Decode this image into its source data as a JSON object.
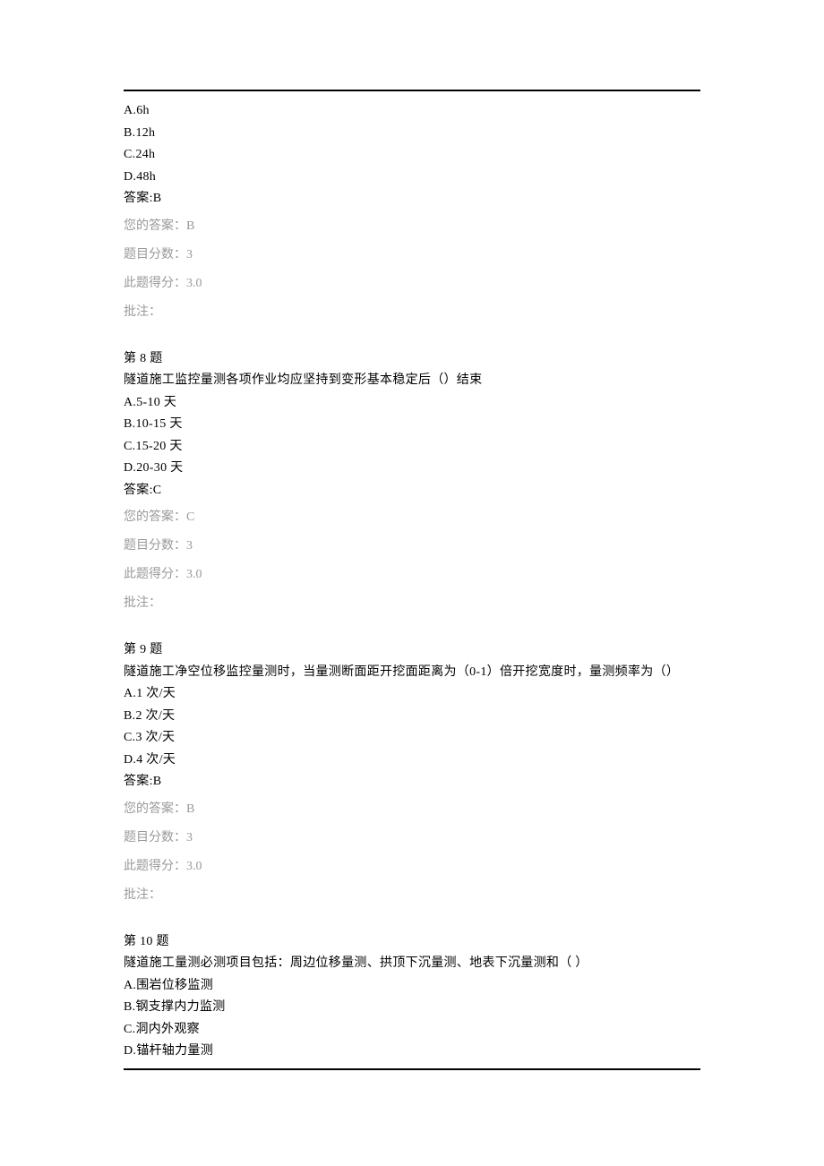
{
  "q7": {
    "options": {
      "A": "A.6h",
      "B": "B.12h",
      "C": "C.24h",
      "D": "D.48h"
    },
    "answer": "答案:B",
    "meta": {
      "your_answer": "您的答案：B",
      "score_label": "题目分数：3",
      "got_label": "此题得分：3.0",
      "remark": "批注："
    }
  },
  "q8": {
    "header": "第 8 题",
    "text": "隧道施工监控量测各项作业均应坚持到变形基本稳定后（）结束",
    "options": {
      "A": "A.5-10 天",
      "B": "B.10-15 天",
      "C": "C.15-20 天",
      "D": "D.20-30 天"
    },
    "answer": "答案:C",
    "meta": {
      "your_answer": "您的答案：C",
      "score_label": "题目分数：3",
      "got_label": "此题得分：3.0",
      "remark": "批注："
    }
  },
  "q9": {
    "header": "第 9 题",
    "text": "隧道施工净空位移监控量测时，当量测断面距开挖面距离为（0-1）倍开挖宽度时，量测频率为（）",
    "options": {
      "A": "A.1 次/天",
      "B": "B.2 次/天",
      "C": "C.3 次/天",
      "D": "D.4 次/天"
    },
    "answer": "答案:B",
    "meta": {
      "your_answer": "您的答案：B",
      "score_label": "题目分数：3",
      "got_label": "此题得分：3.0",
      "remark": "批注："
    }
  },
  "q10": {
    "header": "第 10 题",
    "text": "隧道施工量测必测项目包括：周边位移量测、拱顶下沉量测、地表下沉量测和（ ）",
    "options": {
      "A": "A.围岩位移监测",
      "B": "B.钢支撑内力监测",
      "C": "C.洞内外观察",
      "D": "D.锚杆轴力量测"
    }
  }
}
